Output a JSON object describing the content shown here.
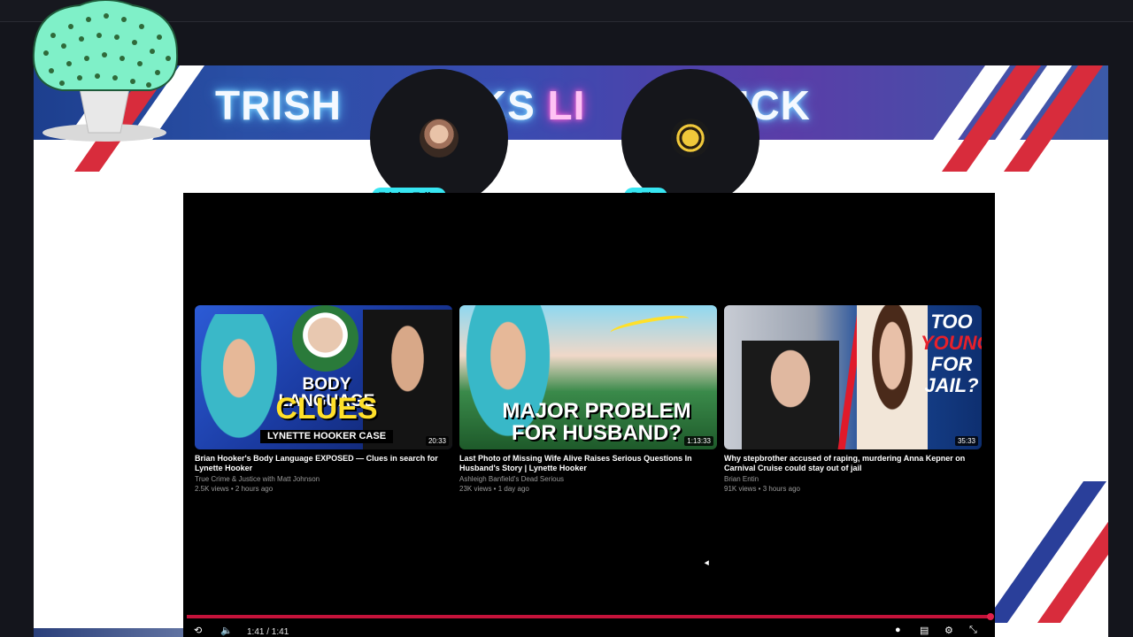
{
  "banner": {
    "title_part1": "TRISH ",
    "title_part2": "LKS",
    "title_part3": " LI",
    "title_part4": "N KICK"
  },
  "participants": [
    {
      "name": "Trisha Talks"
    },
    {
      "name": "B Tim"
    }
  ],
  "videos": [
    {
      "title": "Brian Hooker's Body Language EXPOSED — Clues in search for Lynette Hooker",
      "channel": "True Crime & Justice with Matt Johnson",
      "meta": "2.5K views • 2 hours ago",
      "duration": "20:33",
      "thumb_text_1": "BODY LANGUAGE",
      "thumb_text_2": "CLUES",
      "thumb_text_3": "LYNETTE HOOKER CASE"
    },
    {
      "title": "Last Photo of Missing Wife Alive Raises Serious Questions In Husband's Story | Lynette Hooker",
      "channel": "Ashleigh Banfield's Dead Serious",
      "meta": "23K views • 1 day ago",
      "duration": "1:13:33",
      "thumb_text_1": "MAJOR PROBLEM",
      "thumb_text_2": "FOR HUSBAND?"
    },
    {
      "title": "Why stepbrother accused of raping, murdering Anna Kepner on Carnival Cruise could stay out of jail",
      "channel": "Brian Entin",
      "meta": "91K views • 3 hours ago",
      "duration": "35:33",
      "thumb_text_1": "TOO",
      "thumb_text_2": "YOUNG",
      "thumb_text_3": "FOR",
      "thumb_text_4": "JAIL?"
    }
  ],
  "player": {
    "time": "1:41 / 1:41",
    "progress": 1.0
  },
  "colors": {
    "accent_cyan": "#37e6f2",
    "progress_red": "#c4123a",
    "banner_pink": "#ff6fdc"
  },
  "icons": [
    "replay-icon",
    "volume-icon",
    "captions-icon",
    "settings-icon",
    "fullscreen-exit-icon",
    "autoplay-toggle-icon"
  ]
}
